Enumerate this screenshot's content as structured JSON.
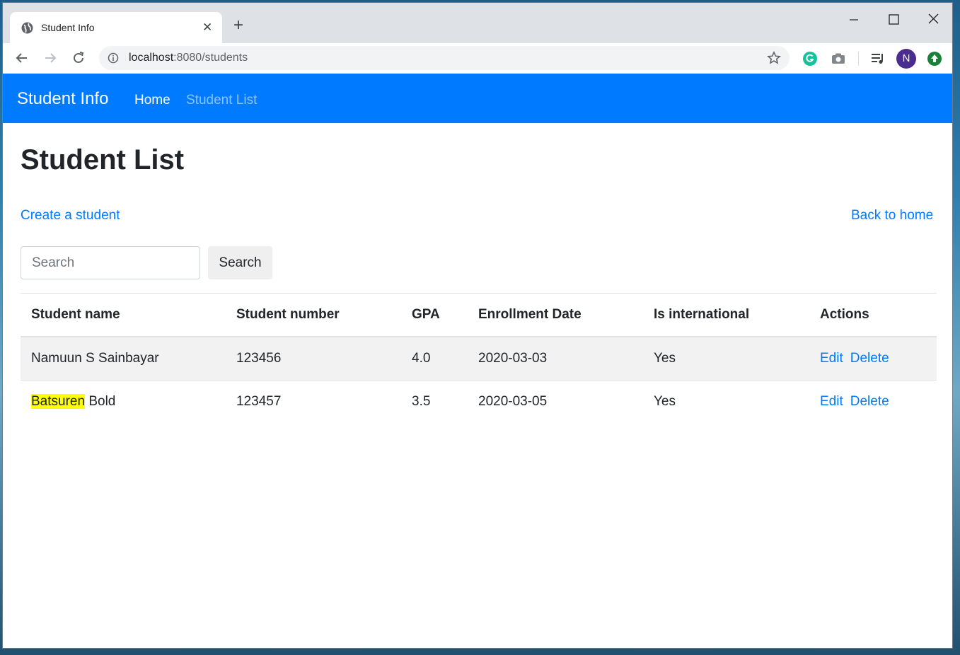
{
  "browser": {
    "tab_title": "Student Info",
    "tab_close": "✕",
    "new_tab": "+",
    "url_host": "localhost",
    "url_rest": ":8080/students",
    "avatar_letter": "N"
  },
  "navbar": {
    "brand": "Student Info",
    "home": "Home",
    "student_list": "Student List"
  },
  "page": {
    "title": "Student List",
    "create_link": "Create a student",
    "home_link": "Back to home",
    "search_placeholder": "Search",
    "search_button": "Search"
  },
  "table": {
    "headers": [
      "Student name",
      "Student number",
      "GPA",
      "Enrollment Date",
      "Is international",
      "Actions"
    ],
    "rows": [
      {
        "name_highlight": "",
        "name_rest": "Namuun S Sainbayar",
        "number": "123456",
        "gpa": "4.0",
        "date": "2020-03-03",
        "international": "Yes",
        "edit": "Edit",
        "delete": "Delete"
      },
      {
        "name_highlight": "Batsuren",
        "name_rest": " Bold",
        "number": "123457",
        "gpa": "3.5",
        "date": "2020-03-05",
        "international": "Yes",
        "edit": "Edit",
        "delete": "Delete"
      }
    ]
  },
  "colors": {
    "navbar": "#007bff",
    "link": "#007bff",
    "highlight": "#ffff00"
  }
}
